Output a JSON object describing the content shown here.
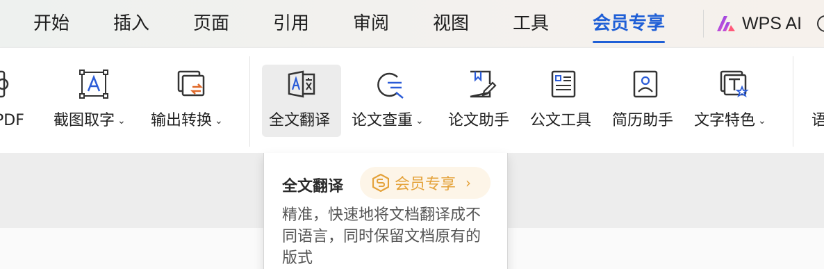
{
  "tabs": [
    {
      "label": "开始",
      "active": false
    },
    {
      "label": "插入",
      "active": false
    },
    {
      "label": "页面",
      "active": false
    },
    {
      "label": "引用",
      "active": false
    },
    {
      "label": "审阅",
      "active": false
    },
    {
      "label": "视图",
      "active": false
    },
    {
      "label": "工具",
      "active": false
    },
    {
      "label": "会员专享",
      "active": true
    }
  ],
  "wps_ai": {
    "label": "WPS AI"
  },
  "ribbon": {
    "items": [
      {
        "label": "为PDF",
        "icon": "pdf-icon"
      },
      {
        "label": "截图取字",
        "icon": "screenshot-text-icon",
        "dropdown": true
      },
      {
        "label": "输出转换",
        "icon": "output-convert-icon",
        "dropdown": true
      },
      {
        "label": "全文翻译",
        "icon": "translate-icon",
        "hovered": true
      },
      {
        "label": "论文查重",
        "icon": "plagiarism-check-icon",
        "dropdown": true
      },
      {
        "label": "论文助手",
        "icon": "paper-assistant-icon"
      },
      {
        "label": "公文工具",
        "icon": "official-doc-icon"
      },
      {
        "label": "简历助手",
        "icon": "resume-assistant-icon"
      },
      {
        "label": "文字特色",
        "icon": "text-feature-icon",
        "dropdown": true
      },
      {
        "label": "语"
      }
    ]
  },
  "tooltip": {
    "title": "全文翻译",
    "badge": "会员专享",
    "description": "精准，快速地将文档翻译成不同语言，同时保留文档原有的版式"
  },
  "colors": {
    "accent": "#1f5fd6",
    "member_gold": "#e4a23a",
    "icon_blue": "#2a5bd7"
  }
}
